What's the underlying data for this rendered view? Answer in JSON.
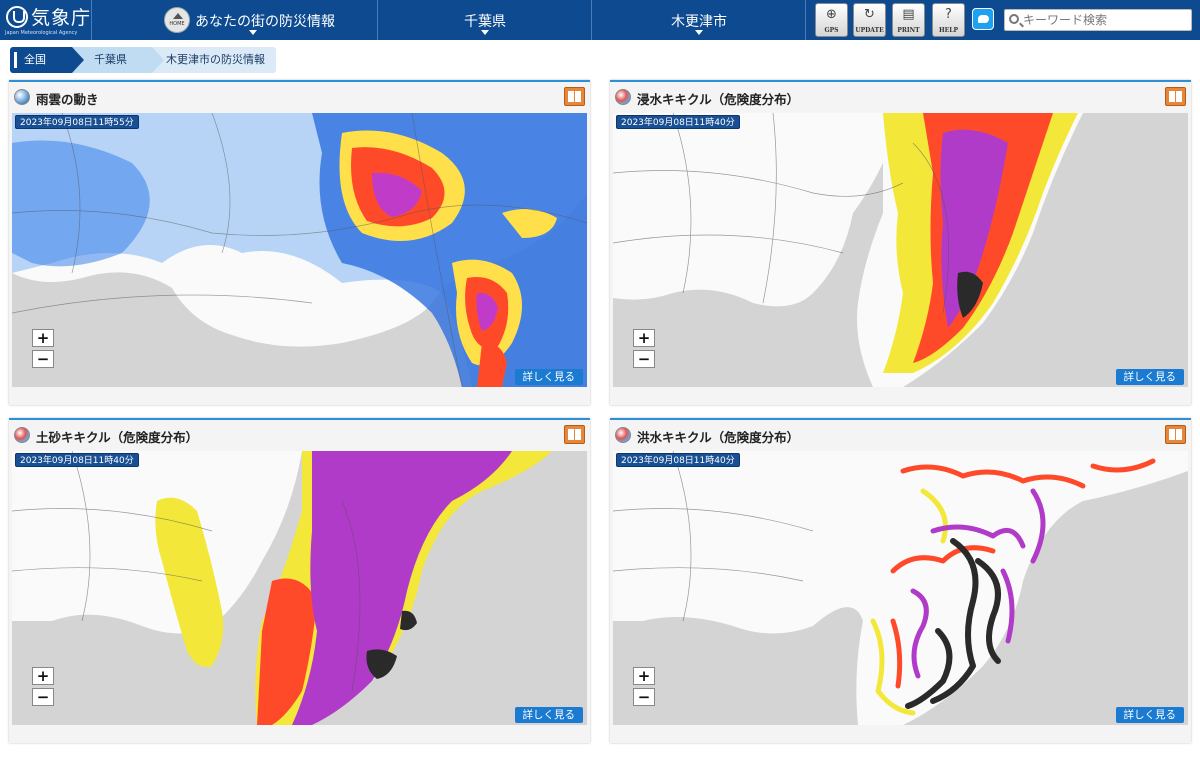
{
  "header": {
    "agency_name": "気象庁",
    "agency_name_en": "Japan Meteorological Agency",
    "home_icon_label": "HOME",
    "nav_home": "あなたの街の防災情報",
    "nav_prefecture": "千葉県",
    "nav_city": "木更津市",
    "tools": [
      {
        "label": "GPS",
        "icon": "gps-icon"
      },
      {
        "label": "UPDATE",
        "icon": "update-icon"
      },
      {
        "label": "PRINT",
        "icon": "print-icon"
      },
      {
        "label": "HELP",
        "icon": "help-icon"
      }
    ],
    "search_placeholder": "キーワード検索"
  },
  "breadcrumb": [
    "全国",
    "千葉県",
    "木更津市の防災情報"
  ],
  "panels": [
    {
      "title": "雨雲の動き",
      "timestamp": "2023年09月08日11時55分",
      "detail_label": "詳しく見る"
    },
    {
      "title": "浸水キキクル（危険度分布）",
      "timestamp": "2023年09月08日11時40分",
      "detail_label": "詳しく見る"
    },
    {
      "title": "土砂キキクル（危険度分布）",
      "timestamp": "2023年09月08日11時40分",
      "detail_label": "詳しく見る"
    },
    {
      "title": "洪水キキクル（危険度分布）",
      "timestamp": "2023年09月08日11時40分",
      "detail_label": "詳しく見る"
    }
  ],
  "map_controls": {
    "zoom_in": "+",
    "zoom_out": "−"
  },
  "colors": {
    "header": "#0d4a90",
    "accent": "#2d8fd5",
    "sea": "#d4d4d4",
    "rain_light": "#a0d2ff",
    "rain_mid": "#2160d8",
    "yellow": "#f2e83c",
    "red": "#ff3c28",
    "purple": "#b03bc8",
    "black": "#2a2a2a"
  }
}
